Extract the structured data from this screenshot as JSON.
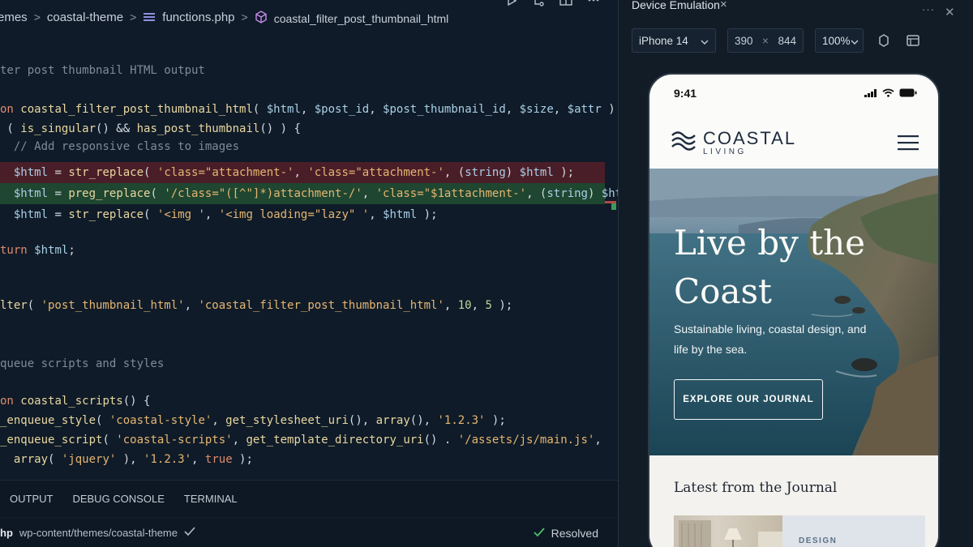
{
  "editor": {
    "breadcrumb": {
      "root": "emes",
      "theme": "coastal-theme",
      "file": "functions.php",
      "symbol": "coastal_filter_post_thumbnail_html"
    },
    "code": {
      "l1": "ter post thumbnail HTML output",
      "l2_kw": "on ",
      "l2_fn": "coastal_filter_post_thumbnail_html",
      "l2_a": "( ",
      "l2_v1": "$html",
      "l2_v2": "$post_id",
      "l2_v3": "$post_thumbnail_id",
      "l2_v4": "$size",
      "l2_v5": "$attr",
      "l2_end": " ) {",
      "l3_a": " ( ",
      "l3_fn1": "is_singular",
      "l3_b": "() && ",
      "l3_fn2": "has_post_thumbnail",
      "l3_c": "() ) {",
      "l4": "  // Add responsive class to images",
      "l5_v": "  $html",
      "l5_a": " = ",
      "l5_fn": "str_replace",
      "l5_b": "( ",
      "l5_s1": "'class=\"attachment-'",
      "l5_s2": "'class=\"attachment-'",
      "l5_c": ", (",
      "l5_t": "string",
      "l5_d": ") ",
      "l5_v2": "$html",
      "l5_e": " );",
      "l6_v": "  $html",
      "l6_fn": "preg_replace",
      "l6_s1": "'/class=\"([^\"]*)attachment-/'",
      "l6_s2": "'class=\"$1attachment-'",
      "l6_t": "string",
      "l6_v2": "$html",
      "l7_v": "  $html",
      "l7_fn": "str_replace",
      "l7_s1": "'<img '",
      "l7_s2": "'<img loading=\"lazy\" '",
      "l7_v2": "$html",
      "l8_kw": "turn ",
      "l8_v": "$html",
      "l8_e": ";",
      "l9_fn": "lter",
      "l9_s1": "'post_thumbnail_html'",
      "l9_s2": "'coastal_filter_post_thumbnail_html'",
      "l9_n1": "10",
      "l9_n2": "5",
      "l10": "queue scripts and styles",
      "l11_kw": "on ",
      "l11_fn": "coastal_scripts",
      "l11_e": "() {",
      "l12_fn": "_enqueue_style",
      "l12_s1": "'coastal-style'",
      "l12_fn2": "get_stylesheet_uri",
      "l12_fn3": "array",
      "l12_s2": "'1.2.3'",
      "l13_fn": "_enqueue_script",
      "l13_s1": "'coastal-scripts'",
      "l13_fn2": "get_template_directory_uri",
      "l13_s2": "'/assets/js/main.js'",
      "l14_fn": "  array",
      "l14_s1": "'jquery'",
      "l14_s2": "'1.2.3'",
      "l14_kw": "true"
    },
    "panel_tabs": [
      "OUTPUT",
      "DEBUG CONSOLE",
      "TERMINAL"
    ],
    "status": {
      "lang": "hp",
      "path": "wp-content/themes/coastal-theme",
      "resolved": "Resolved"
    }
  },
  "devtools": {
    "title": "Device Emulation",
    "close": "×",
    "more": "···",
    "x": "✕",
    "device": "iPhone 14",
    "width": "390",
    "times": "×",
    "height": "844",
    "zoom": "100%"
  },
  "phone": {
    "time": "9:41",
    "brand": "COASTAL",
    "brand_sub": "LIVING",
    "hero_title": "Live by the Coast",
    "hero_sub": "Sustainable living, coastal design, and life by the sea.",
    "hero_cta": "EXPLORE OUR JOURNAL",
    "journal_title": "Latest from the Journal",
    "card_tag": "DESIGN"
  }
}
